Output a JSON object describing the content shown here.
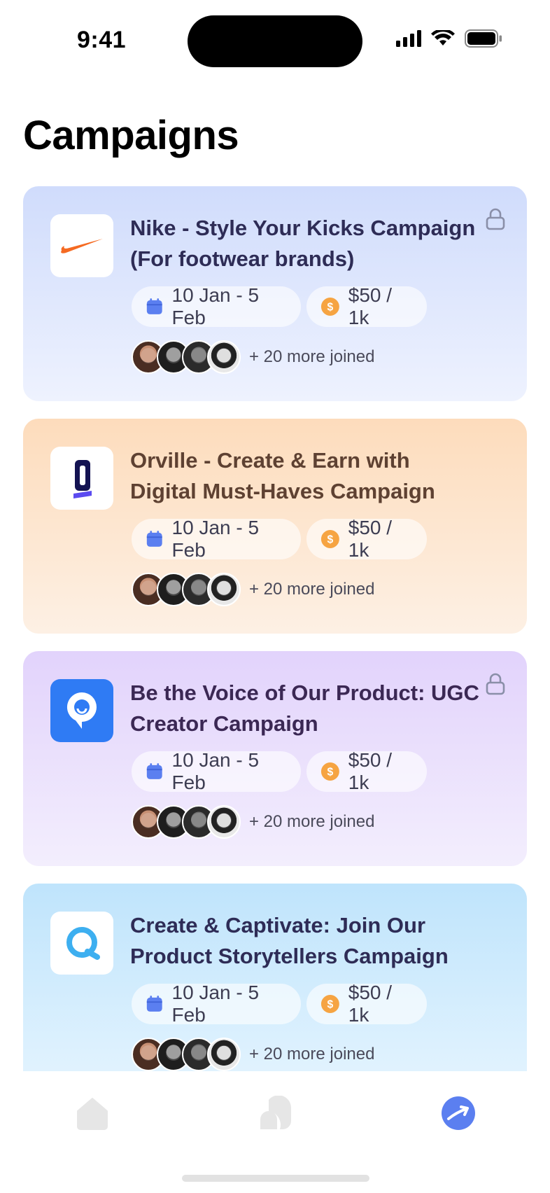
{
  "status_bar": {
    "time": "9:41"
  },
  "page": {
    "title": "Campaigns"
  },
  "campaigns": [
    {
      "title": "Nike - Style Your Kicks Campaign (For footwear brands)",
      "date": "10 Jan - 5 Feb",
      "price": "$50 / 1k",
      "joined": "+ 20 more joined",
      "logo": "nike-logo",
      "locked": true
    },
    {
      "title": "Orville - Create & Earn with Digital Must-Haves Campaign",
      "date": "10 Jan - 5 Feb",
      "price": "$50 / 1k",
      "joined": "+ 20 more joined",
      "logo": "orville-logo",
      "locked": false
    },
    {
      "title": "Be the Voice of Our Product: UGC Creator Campaign",
      "date": "10 Jan - 5 Feb",
      "price": "$50 / 1k",
      "joined": "+ 20 more joined",
      "logo": "chat-bubble-logo",
      "locked": true
    },
    {
      "title": "Create & Captivate: Join Our Product Storytellers Campaign",
      "date": "10 Jan - 5 Feb",
      "price": "$50 / 1k",
      "joined": "+ 20 more joined",
      "logo": "q-logo",
      "locked": false
    }
  ],
  "tabbar": {
    "items": [
      "home-icon",
      "chat-icon",
      "campaigns-icon"
    ],
    "active": "campaigns-icon"
  },
  "colors": {
    "accent": "#5b7ff0",
    "coin": "#f6a442",
    "calendar": "#5b7ff0"
  }
}
